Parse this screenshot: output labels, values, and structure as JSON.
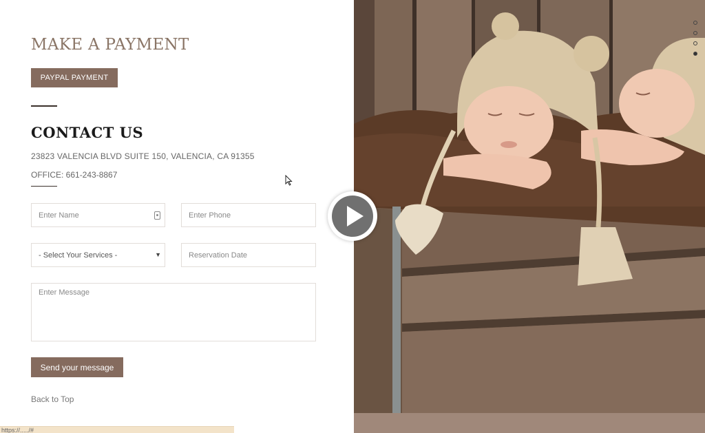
{
  "payment": {
    "title": "MAKE A PAYMENT",
    "paypal_button": "PAYPAL PAYMENT"
  },
  "contact": {
    "title": "CONTACT US",
    "address": "23823 VALENCIA BLVD SUITE 150, VALENCIA, CA 91355",
    "office": "OFFICE: 661-243-8867"
  },
  "form": {
    "name_placeholder": "Enter Name",
    "phone_placeholder": "Enter Phone",
    "service_selected": "- Select Your Services -",
    "date_placeholder": "Reservation Date",
    "message_placeholder": "Enter Message",
    "send_button": "Send your message"
  },
  "footer": {
    "back_to_top": "Back to Top",
    "status_url": "https://...../#"
  },
  "slider": {
    "dot_count": 4,
    "active_dot": 4
  },
  "colors": {
    "accent": "#856b5e",
    "title_payment": "#8a7566"
  }
}
